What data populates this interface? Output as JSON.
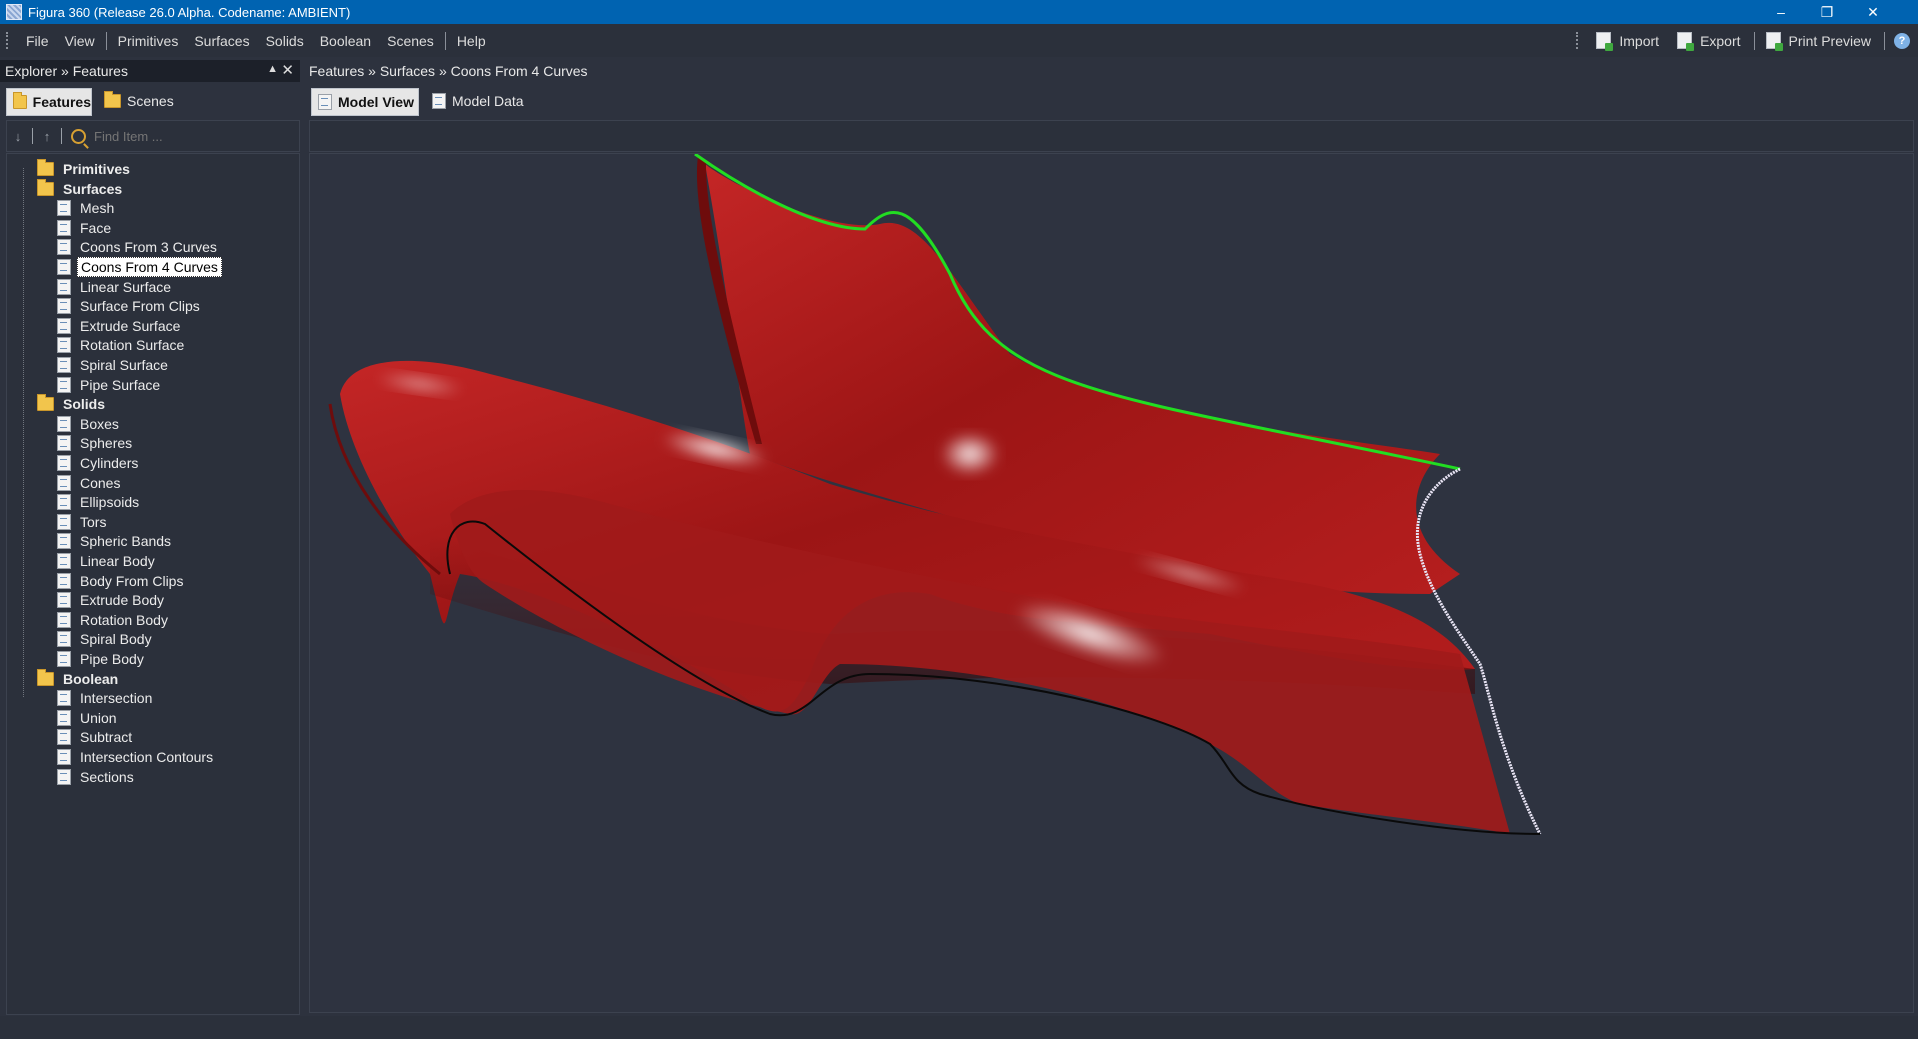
{
  "window": {
    "title": "Figura 360 (Release 26.0 Alpha. Codename: AMBIENT)"
  },
  "menu": [
    "File",
    "View",
    "Primitives",
    "Surfaces",
    "Solids",
    "Boolean",
    "Scenes",
    "Help"
  ],
  "toolbar": {
    "import": "Import",
    "export": "Export",
    "print_preview": "Print Preview"
  },
  "explorer": {
    "title": "Explorer » Features",
    "tabs": [
      "Features",
      "Scenes"
    ],
    "search_placeholder": "Find Item ..."
  },
  "tree": [
    {
      "label": "Primitives",
      "level": 0,
      "group": true
    },
    {
      "label": "Surfaces",
      "level": 0,
      "group": true
    },
    {
      "label": "Mesh",
      "level": 1
    },
    {
      "label": "Face",
      "level": 1
    },
    {
      "label": "Coons From 3 Curves",
      "level": 1
    },
    {
      "label": "Coons From 4 Curves",
      "level": 1,
      "selected": true
    },
    {
      "label": "Linear Surface",
      "level": 1
    },
    {
      "label": "Surface From Clips",
      "level": 1
    },
    {
      "label": "Extrude Surface",
      "level": 1
    },
    {
      "label": "Rotation Surface",
      "level": 1
    },
    {
      "label": "Spiral Surface",
      "level": 1
    },
    {
      "label": "Pipe Surface",
      "level": 1
    },
    {
      "label": "Solids",
      "level": 0,
      "group": true
    },
    {
      "label": "Boxes",
      "level": 1
    },
    {
      "label": "Spheres",
      "level": 1
    },
    {
      "label": "Cylinders",
      "level": 1
    },
    {
      "label": "Cones",
      "level": 1
    },
    {
      "label": "Ellipsoids",
      "level": 1
    },
    {
      "label": "Tors",
      "level": 1
    },
    {
      "label": "Spheric Bands",
      "level": 1
    },
    {
      "label": "Linear Body",
      "level": 1
    },
    {
      "label": "Body From Clips",
      "level": 1
    },
    {
      "label": "Extrude Body",
      "level": 1
    },
    {
      "label": "Rotation Body",
      "level": 1
    },
    {
      "label": "Spiral Body",
      "level": 1
    },
    {
      "label": "Pipe Body",
      "level": 1
    },
    {
      "label": "Boolean",
      "level": 0,
      "group": true
    },
    {
      "label": "Intersection",
      "level": 1
    },
    {
      "label": "Union",
      "level": 1
    },
    {
      "label": "Subtract",
      "level": 1
    },
    {
      "label": "Intersection Contours",
      "level": 1
    },
    {
      "label": "Sections",
      "level": 1
    }
  ],
  "main": {
    "breadcrumb": "Features » Surfaces » Coons From 4 Curves",
    "tabs": [
      "Model View",
      "Model Data"
    ]
  },
  "colors": {
    "surface": "#a91c1c",
    "curve_green": "#22dd22",
    "curve_white": "#e8e4f4",
    "curve_black": "#0a0a0a",
    "background": "#2e3340"
  }
}
